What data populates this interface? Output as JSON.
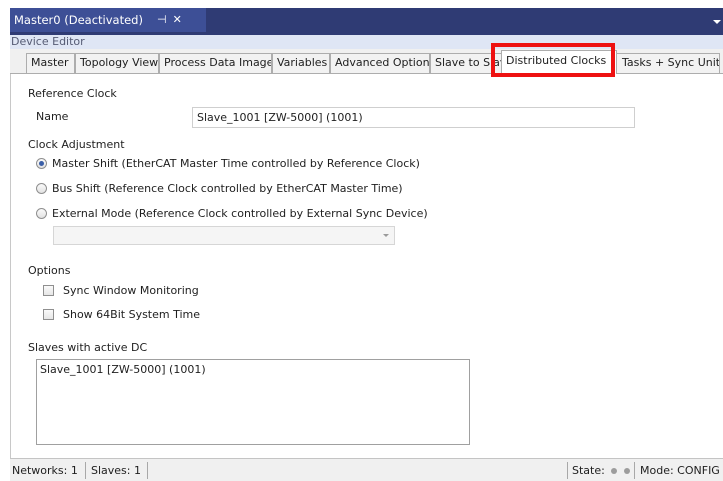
{
  "document_tab": {
    "title": "Master0 (Deactivated)",
    "pin_glyph": "⊣",
    "close_glyph": "✕"
  },
  "editor": {
    "header": "Device Editor"
  },
  "tabs": [
    {
      "label": "Master"
    },
    {
      "label": "Topology View"
    },
    {
      "label": "Process Data Image"
    },
    {
      "label": "Variables"
    },
    {
      "label": "Advanced Options"
    },
    {
      "label": "Slave to Slave"
    },
    {
      "label": "Distributed Clocks",
      "active": true
    },
    {
      "label": "Tasks + Sync Units"
    }
  ],
  "reference_clock": {
    "title": "Reference Clock",
    "name_label": "Name",
    "name_value": "Slave_1001 [ZW-5000] (1001)"
  },
  "clock_adjustment": {
    "title": "Clock Adjustment",
    "options": [
      {
        "label": "Master Shift (EtherCAT Master Time controlled by Reference Clock)",
        "checked": true
      },
      {
        "label": "Bus Shift (Reference Clock controlled by EtherCAT Master Time)",
        "checked": false
      },
      {
        "label": "External Mode (Reference Clock controlled by External Sync Device)",
        "checked": false
      }
    ],
    "external_device_value": ""
  },
  "options": {
    "title": "Options",
    "sync_window_monitoring": {
      "label": "Sync Window Monitoring",
      "checked": false
    },
    "show_64bit_time": {
      "label": "Show 64Bit System Time",
      "checked": false
    }
  },
  "active_dc": {
    "title": "Slaves with active DC",
    "items": [
      "Slave_1001 [ZW-5000] (1001)"
    ]
  },
  "status_bar": {
    "networks": "Networks: 1",
    "slaves": "Slaves: 1",
    "state_label": "State:",
    "mode": "Mode: CONFIG"
  },
  "colors": {
    "title_bar": "#2f3b74",
    "highlight": "#ee1111",
    "header": "#dfe6f5"
  }
}
